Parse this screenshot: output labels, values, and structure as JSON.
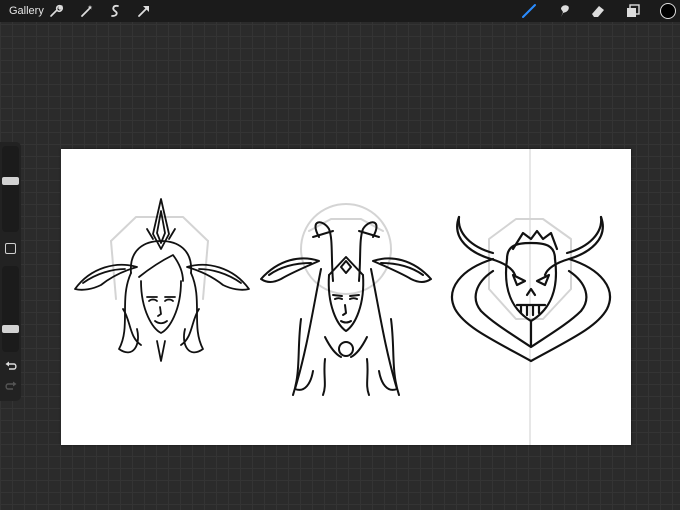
{
  "toolbar": {
    "gallery_label": "Gallery",
    "left_tools": [
      "wrench-icon",
      "magic-wand-icon",
      "selection-icon",
      "transform-arrow-icon"
    ],
    "right_tools": [
      "brush-icon",
      "smudge-icon",
      "eraser-icon",
      "layers-icon"
    ],
    "active_tool": "brush-icon",
    "active_tool_color": "#2a8cff",
    "color_swatch": "#000000"
  },
  "sidebar": {
    "brush_size_level": 0.6,
    "brush_opacity_level": 0.25,
    "controls": [
      "brush-size-slider",
      "modify-button",
      "brush-opacity-slider",
      "undo-button",
      "redo-button"
    ]
  },
  "canvas": {
    "background": "#ffffff",
    "artwork": [
      "angel-portrait-drawing",
      "horned-woman-portrait-drawing",
      "demon-mask-drawing"
    ]
  }
}
